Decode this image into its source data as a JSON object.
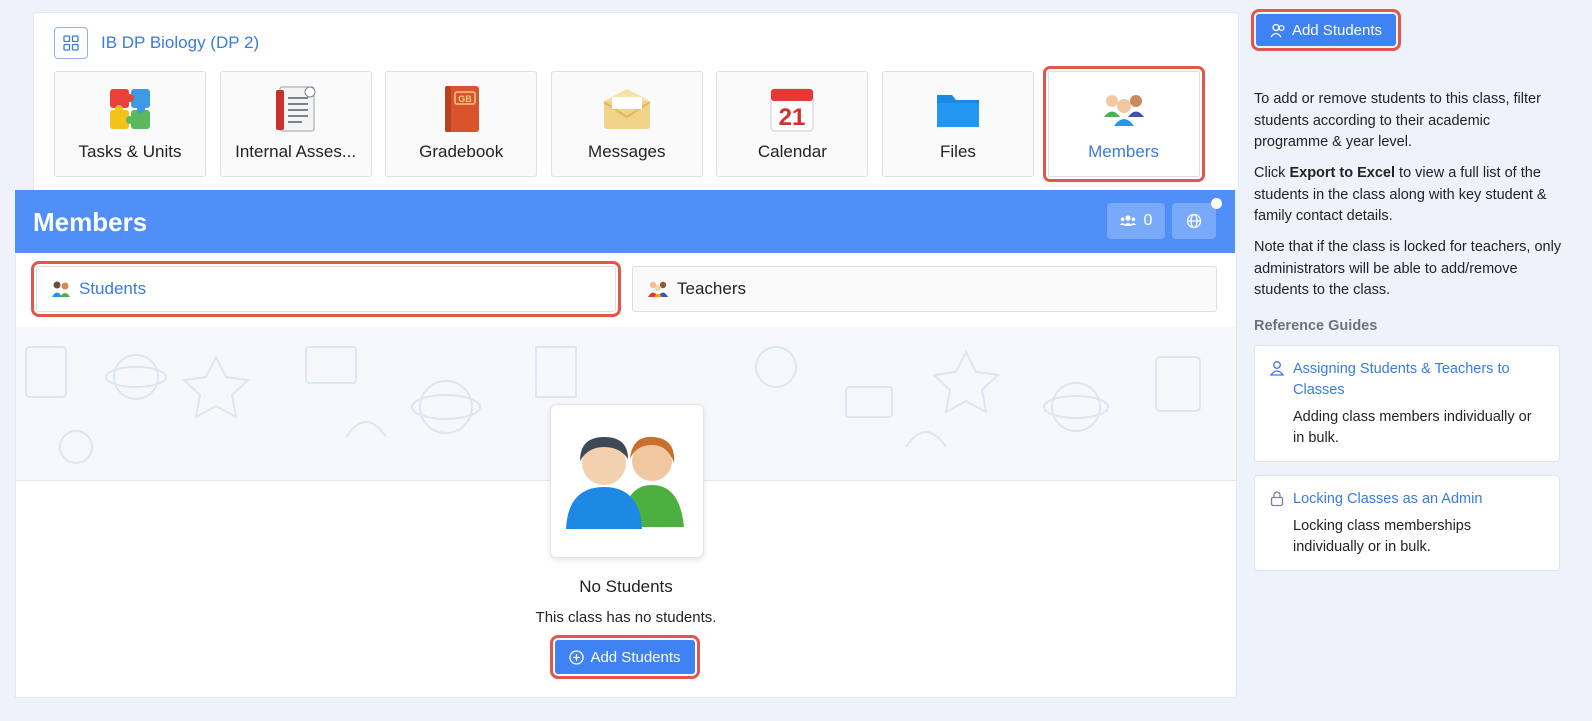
{
  "class": {
    "title": "IB DP Biology (DP 2)",
    "tiles": [
      {
        "label": "Tasks & Units",
        "icon": "puzzle-icon"
      },
      {
        "label": "Internal Asses...",
        "icon": "assessment-icon"
      },
      {
        "label": "Gradebook",
        "icon": "gradebook-icon"
      },
      {
        "label": "Messages",
        "icon": "envelope-icon"
      },
      {
        "label": "Calendar",
        "icon": "calendar-icon",
        "calendar_day": "21"
      },
      {
        "label": "Files",
        "icon": "folder-icon"
      },
      {
        "label": "Members",
        "icon": "members-icon",
        "active": true
      }
    ]
  },
  "members": {
    "title": "Members",
    "member_count": "0",
    "tabs": [
      {
        "label": "Students",
        "active": true
      },
      {
        "label": "Teachers",
        "active": false
      }
    ],
    "empty": {
      "title": "No Students",
      "subtitle": "This class has no students.",
      "button_label": "Add Students"
    }
  },
  "sidebar": {
    "add_button_label": "Add Students",
    "paragraph1": "To add or remove students to this class, filter students according to their academic programme & year level.",
    "paragraph2_prefix": "Click ",
    "paragraph2_bold": "Export to Excel",
    "paragraph2_suffix": " to view a full list of the students in the class along with key student & family contact details.",
    "paragraph3": "Note that if the class is locked for teachers, only administrators will be able to add/remove students to the class.",
    "reference_heading": "Reference Guides",
    "guides": [
      {
        "title": "Assigning Students & Teachers to Classes",
        "description": "Adding class members individually or in bulk.",
        "icon": "user-outline-icon"
      },
      {
        "title": "Locking Classes as an Admin",
        "description": "Locking class memberships individually or in bulk.",
        "icon": "lock-icon"
      }
    ]
  },
  "colors": {
    "accent": "#3f82f4",
    "header_blue": "#4f8ff7",
    "highlight_red": "#e2574c",
    "link_blue": "#3a7be0"
  }
}
